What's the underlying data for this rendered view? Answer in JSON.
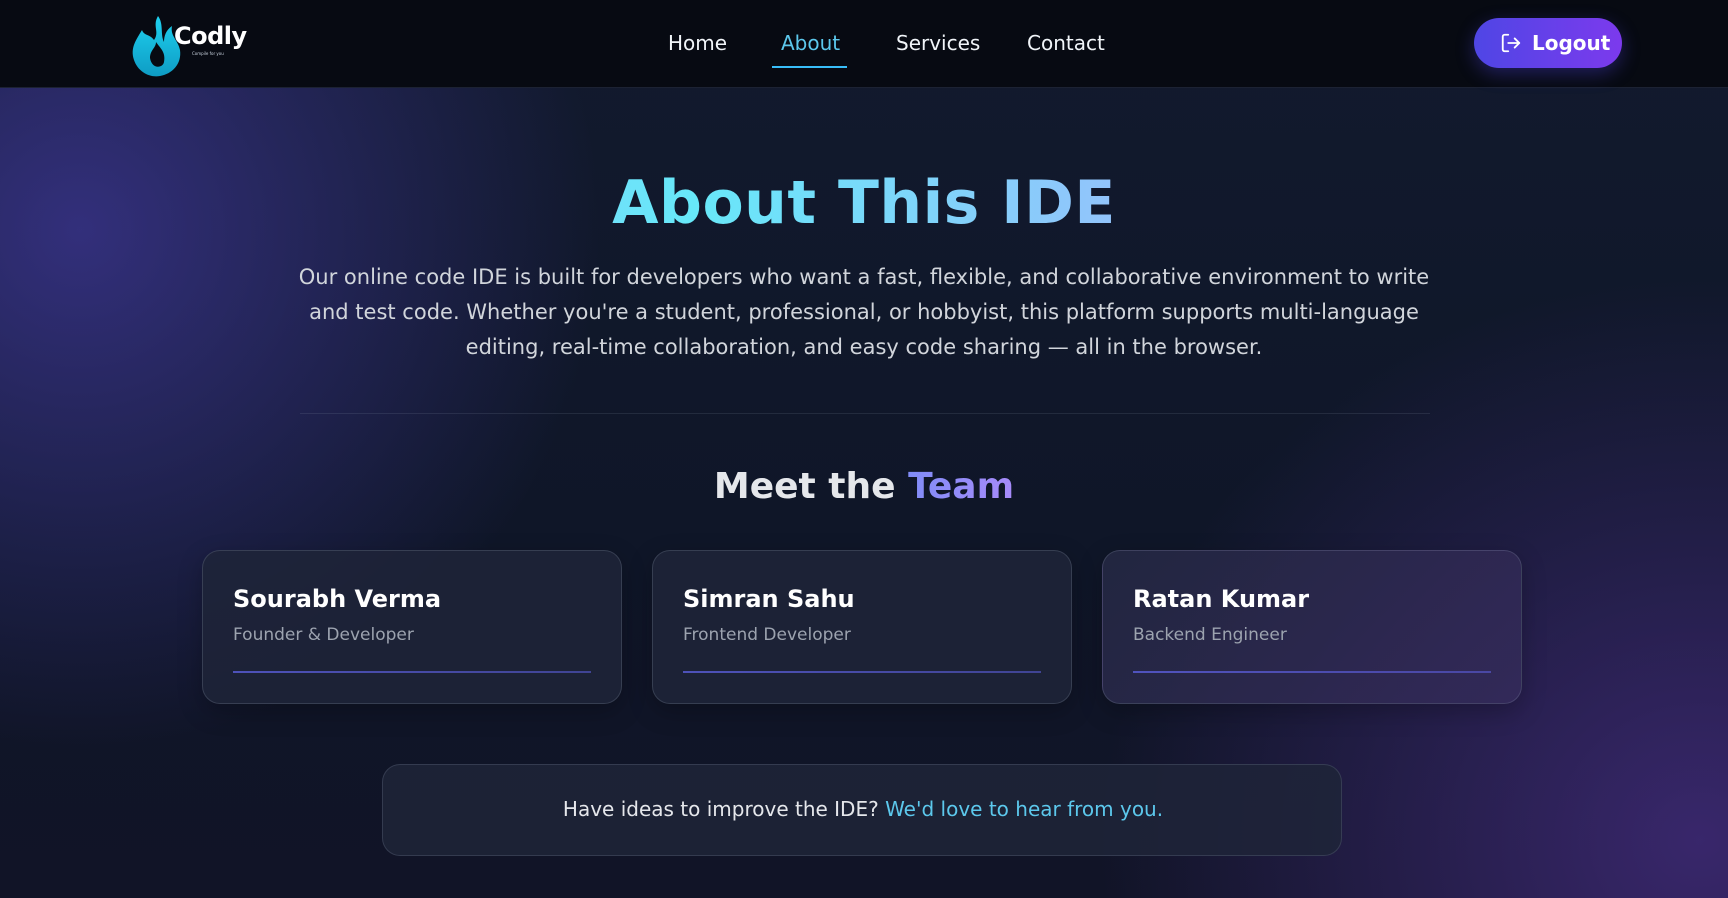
{
  "brand": {
    "name": "Codly",
    "tagline": "Compile for you",
    "logo_icon": "flame-icon",
    "accent": "#19b8e0"
  },
  "nav": {
    "items": [
      {
        "label": "Home",
        "active": false
      },
      {
        "label": "About",
        "active": true
      },
      {
        "label": "Services",
        "active": false
      },
      {
        "label": "Contact",
        "active": false
      }
    ],
    "active_color": "#5cc8ec"
  },
  "logout": {
    "label": "Logout",
    "icon": "logout-icon",
    "gradient": [
      "#4f46e5",
      "#7c3aed"
    ]
  },
  "hero": {
    "title": "About This IDE",
    "description": "Our online code IDE is built for developers who want a fast, flexible, and collaborative environment to write and test code. Whether you're a student, professional, or hobbyist, this platform supports multi-language editing, real-time collaboration, and easy code sharing — all in the browser."
  },
  "team": {
    "heading_prefix": "Meet the",
    "heading_accent": "Team",
    "members": [
      {
        "name": "Sourabh Verma",
        "role": "Founder & Developer"
      },
      {
        "name": "Simran Sahu",
        "role": "Frontend Developer"
      },
      {
        "name": "Ratan Kumar",
        "role": "Backend Engineer"
      }
    ]
  },
  "cta": {
    "text": "Have ideas to improve the IDE?",
    "link_text": "We'd love to hear from you."
  }
}
